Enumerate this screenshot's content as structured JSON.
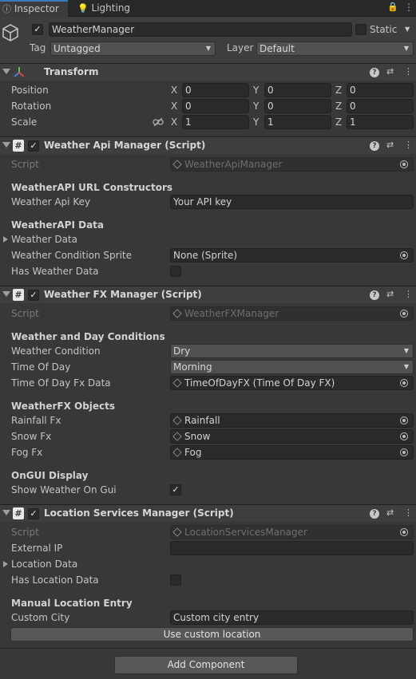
{
  "tabs": {
    "inspector": "Inspector",
    "lighting": "Lighting"
  },
  "go": {
    "name": "WeatherManager",
    "static_label": "Static",
    "tag_label": "Tag",
    "tag_value": "Untagged",
    "layer_label": "Layer",
    "layer_value": "Default"
  },
  "transform": {
    "title": "Transform",
    "position": {
      "label": "Position",
      "x": "0",
      "y": "0",
      "z": "0"
    },
    "rotation": {
      "label": "Rotation",
      "x": "0",
      "y": "0",
      "z": "0"
    },
    "scale": {
      "label": "Scale",
      "x": "1",
      "y": "1",
      "z": "1"
    },
    "axis_x": "X",
    "axis_y": "Y",
    "axis_z": "Z"
  },
  "api": {
    "title": "Weather Api Manager (Script)",
    "script_label": "Script",
    "script_value": "WeatherApiManager",
    "h1": "WeatherAPI URL Constructors",
    "key_label": "Weather Api Key",
    "key_value": "Your API key",
    "h2": "WeatherAPI Data",
    "data_label": "Weather Data",
    "sprite_label": "Weather Condition Sprite",
    "sprite_value": "None (Sprite)",
    "has_label": "Has Weather Data"
  },
  "fx": {
    "title": "Weather FX Manager (Script)",
    "script_label": "Script",
    "script_value": "WeatherFXManager",
    "h1": "Weather and Day Conditions",
    "cond_label": "Weather Condition",
    "cond_value": "Dry",
    "tod_label": "Time Of Day",
    "tod_value": "Morning",
    "todfx_label": "Time Of Day Fx Data",
    "todfx_value": "TimeOfDayFX (Time Of Day FX)",
    "h2": "WeatherFX Objects",
    "rain_label": "Rainfall Fx",
    "rain_value": "Rainfall",
    "snow_label": "Snow Fx",
    "snow_value": "Snow",
    "fog_label": "Fog Fx",
    "fog_value": "Fog",
    "h3": "OnGUI Display",
    "show_label": "Show Weather On Gui"
  },
  "loc": {
    "title": "Location Services Manager (Script)",
    "script_label": "Script",
    "script_value": "LocationServicesManager",
    "ip_label": "External IP",
    "ip_value": "",
    "data_label": "Location Data",
    "has_label": "Has Location Data",
    "h1": "Manual Location Entry",
    "city_label": "Custom City",
    "city_value": "Custom city entry",
    "use_button": "Use custom location"
  },
  "add_component": "Add Component",
  "icons": {
    "lock": "lock-icon",
    "menu": "kebab-menu-icon"
  }
}
